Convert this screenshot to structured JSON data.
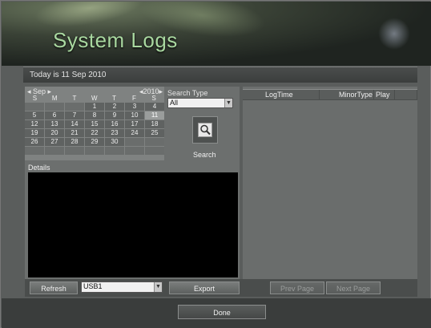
{
  "window": {
    "title": "System Logs"
  },
  "date_bar": {
    "text": "Today is 11 Sep 2010"
  },
  "calendar": {
    "month_label": "◂ Sep ▸",
    "year_label": "◂2010▸",
    "weekdays": [
      "S",
      "M",
      "T",
      "W",
      "T",
      "F",
      "S"
    ],
    "selected_day": "11",
    "weeks": [
      [
        "",
        "",
        "",
        "1",
        "2",
        "3",
        "4"
      ],
      [
        "5",
        "6",
        "7",
        "8",
        "9",
        "10",
        "11"
      ],
      [
        "12",
        "13",
        "14",
        "15",
        "16",
        "17",
        "18"
      ],
      [
        "19",
        "20",
        "21",
        "22",
        "23",
        "24",
        "25"
      ],
      [
        "26",
        "27",
        "28",
        "29",
        "30",
        "",
        ""
      ],
      [
        "",
        "",
        "",
        "",
        "",
        "",
        ""
      ]
    ]
  },
  "search": {
    "type_label": "Search Type",
    "type_value": "All",
    "button_label": "Search",
    "icon": "search-icon"
  },
  "details": {
    "label": "Details"
  },
  "table": {
    "columns": [
      "LogTime",
      "MinorType",
      "Play"
    ]
  },
  "bottom": {
    "refresh_label": "Refresh",
    "device_value": "USB1",
    "export_label": "Export",
    "prev_label": "Prev Page",
    "next_label": "Next Page"
  },
  "footer": {
    "done_label": "Done"
  }
}
